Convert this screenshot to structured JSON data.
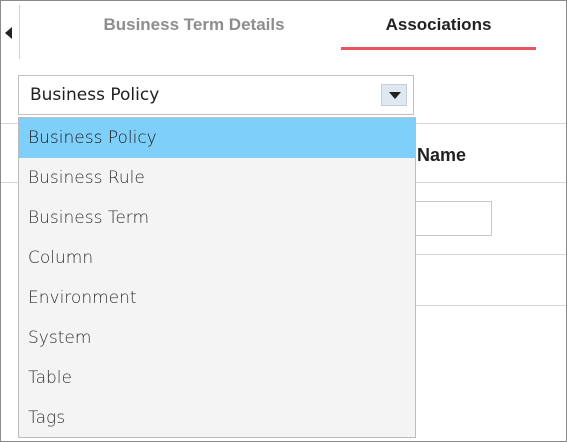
{
  "tabs": [
    {
      "label": "Business Term Details",
      "active": false
    },
    {
      "label": "Associations",
      "active": true
    }
  ],
  "select": {
    "value": "Business Policy",
    "options": [
      "Business Policy",
      "Business Rule",
      "Business Term",
      "Column",
      "Environment",
      "System",
      "Table",
      "Tags"
    ],
    "selected_index": 0
  },
  "table": {
    "name_header": "Name"
  },
  "colors": {
    "active_tab_underline": "#e8555f",
    "selected_option": "#7ed0fa",
    "dropdown_background": "#f4f4f4"
  }
}
